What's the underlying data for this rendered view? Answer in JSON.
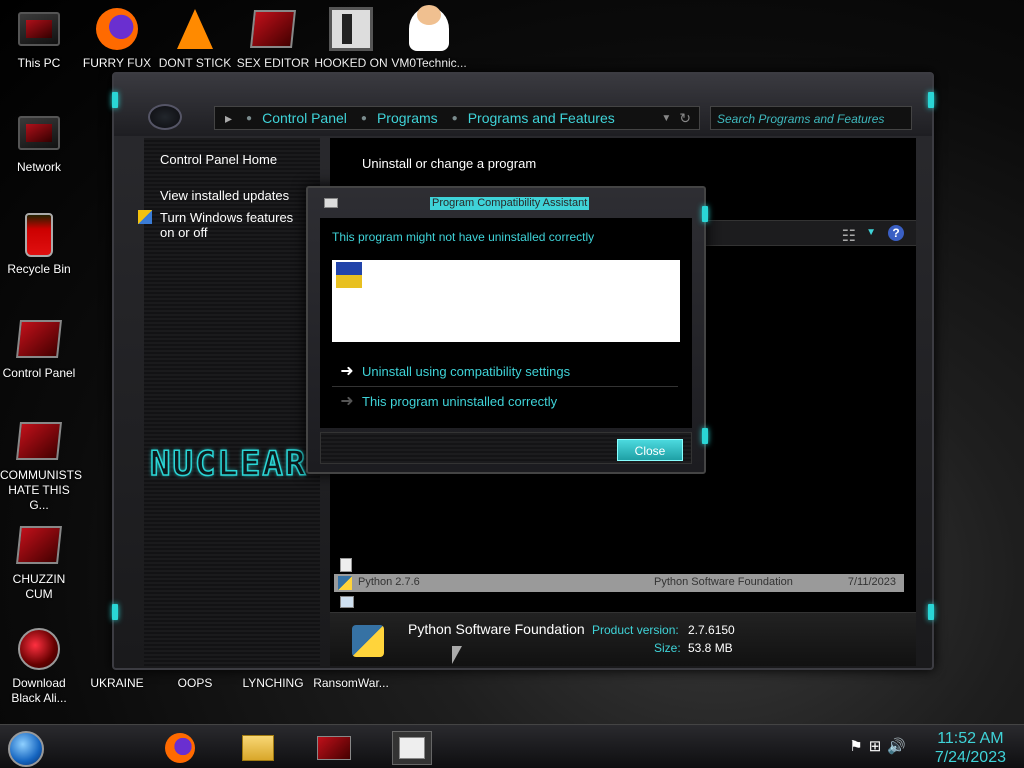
{
  "desktop": {
    "icons": [
      {
        "label": "This PC",
        "icon": "monitor-icon"
      },
      {
        "label": "FURRY FUX",
        "icon": "firefox-icon"
      },
      {
        "label": "DONT STICK",
        "icon": "vlc-cone-icon"
      },
      {
        "label": "SEX EDITOR",
        "icon": "red-monitor-icon"
      },
      {
        "label": "HOOKED ON",
        "icon": "hooked-icon"
      },
      {
        "label": "VM0Technic...",
        "icon": "doctor-icon"
      },
      {
        "label": "Network",
        "icon": "network-monitor-icon"
      },
      {
        "label": "Recycle Bin",
        "icon": "recycle-bin-icon"
      },
      {
        "label": "Control Panel",
        "icon": "control-panel-icon"
      },
      {
        "label": "COMMUNISTS HATE THIS G...",
        "icon": "red-monitor-icon"
      },
      {
        "label": "CHUZZIN CUM",
        "icon": "red-monitor-icon"
      },
      {
        "label": "Download Black Ali...",
        "icon": "orb-icon"
      },
      {
        "label": "UKRAINE",
        "icon": "file-icon"
      },
      {
        "label": "OOPS",
        "icon": "file-icon"
      },
      {
        "label": "LYNCHING",
        "icon": "file-icon"
      },
      {
        "label": "RansomWar...",
        "icon": "file-icon"
      }
    ]
  },
  "window": {
    "breadcrumb": [
      "Control Panel",
      "Programs",
      "Programs and Features"
    ],
    "search_placeholder": "Search Programs and Features",
    "sidebar": {
      "home": "Control Panel Home",
      "updates": "View installed updates",
      "features": "Turn Windows features on or off"
    },
    "logo_text": "NUCLEAR",
    "content_title": "Uninstall or change a program",
    "selected_row": {
      "name": "Python 2.7.6",
      "publisher": "Python Software Foundation",
      "date": "7/11/2023"
    },
    "details": {
      "publisher": "Python Software Foundation",
      "version_label": "Product version:",
      "version": "2.7.6150",
      "size_label": "Size:",
      "size": "53.8 MB"
    }
  },
  "dialog": {
    "title": "Program Compatibility Assistant",
    "message": "This program might not have uninstalled correctly",
    "option_1": "Uninstall using compatibility settings",
    "option_2": "This program uninstalled correctly",
    "close_label": "Close"
  },
  "taskbar": {
    "time": "11:52 AM",
    "date": "7/24/2023"
  },
  "colors": {
    "accent": "#3fd3d8",
    "window_bg": "#1a1a1c"
  }
}
